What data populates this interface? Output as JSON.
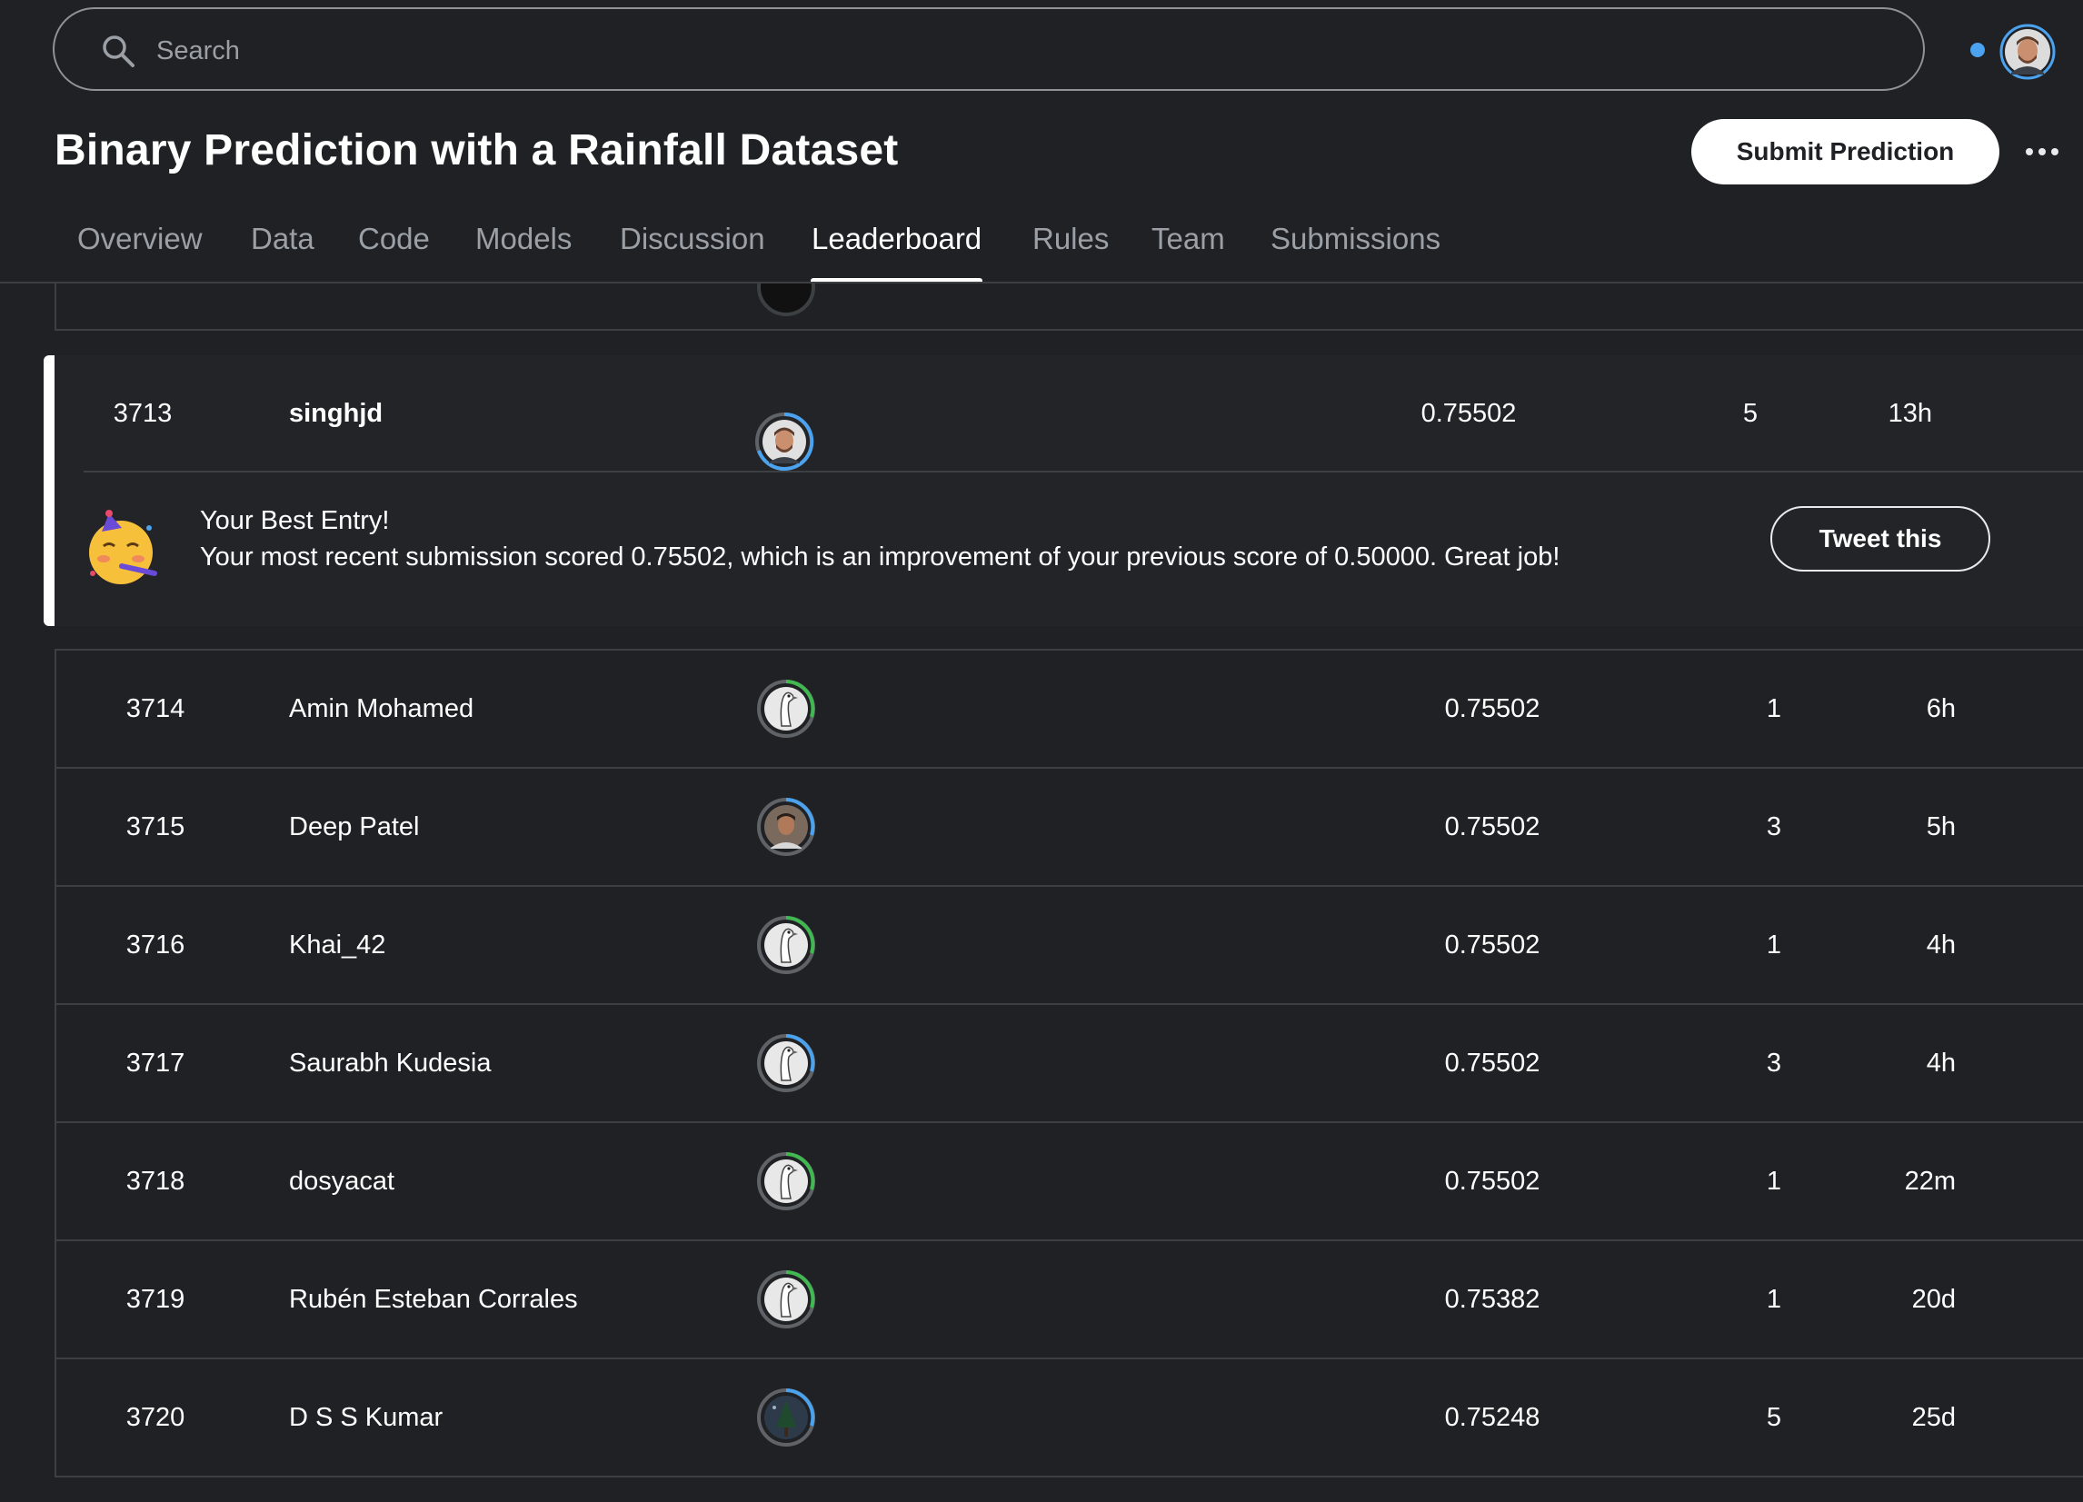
{
  "search": {
    "placeholder": "Search"
  },
  "header": {
    "title": "Binary Prediction with a Rainfall Dataset",
    "submit_label": "Submit Prediction"
  },
  "tabs": [
    {
      "label": "Overview",
      "active": false
    },
    {
      "label": "Data",
      "active": false
    },
    {
      "label": "Code",
      "active": false
    },
    {
      "label": "Models",
      "active": false
    },
    {
      "label": "Discussion",
      "active": false
    },
    {
      "label": "Leaderboard",
      "active": true
    },
    {
      "label": "Rules",
      "active": false
    },
    {
      "label": "Team",
      "active": false
    },
    {
      "label": "Submissions",
      "active": false
    }
  ],
  "highlight": {
    "rank": "3713",
    "name": "singhjd",
    "score": "0.75502",
    "entries": "5",
    "last": "13h",
    "message_title": "Your Best Entry!",
    "message_text": "Your most recent submission scored 0.75502, which is an improvement of your previous score of 0.50000. Great job!",
    "tweet_label": "Tweet this"
  },
  "rows": [
    {
      "rank": "3714",
      "name": "Amin Mohamed",
      "score": "0.75502",
      "entries": "1",
      "last": "6h",
      "ring": "#3fb950",
      "avatar": "goose-icon"
    },
    {
      "rank": "3715",
      "name": "Deep Patel",
      "score": "0.75502",
      "entries": "3",
      "last": "5h",
      "ring": "#4ba3ef",
      "avatar": "person-photo"
    },
    {
      "rank": "3716",
      "name": "Khai_42",
      "score": "0.75502",
      "entries": "1",
      "last": "4h",
      "ring": "#3fb950",
      "avatar": "goose-icon"
    },
    {
      "rank": "3717",
      "name": "Saurabh Kudesia",
      "score": "0.75502",
      "entries": "3",
      "last": "4h",
      "ring": "#4ba3ef",
      "avatar": "goose-icon"
    },
    {
      "rank": "3718",
      "name": "dosyacat",
      "score": "0.75502",
      "entries": "1",
      "last": "22m",
      "ring": "#3fb950",
      "avatar": "goose-icon"
    },
    {
      "rank": "3719",
      "name": "Rubén Esteban Corrales",
      "score": "0.75382",
      "entries": "1",
      "last": "20d",
      "ring": "#3fb950",
      "avatar": "goose-icon"
    },
    {
      "rank": "3720",
      "name": "D S S Kumar",
      "score": "0.75248",
      "entries": "5",
      "last": "25d",
      "ring": "#4ba3ef",
      "avatar": "tree-photo"
    }
  ],
  "colors": {
    "background": "#202124",
    "notification_dot": "#4ba3ef",
    "tier_blue": "#4ba3ef",
    "tier_green": "#3fb950"
  }
}
